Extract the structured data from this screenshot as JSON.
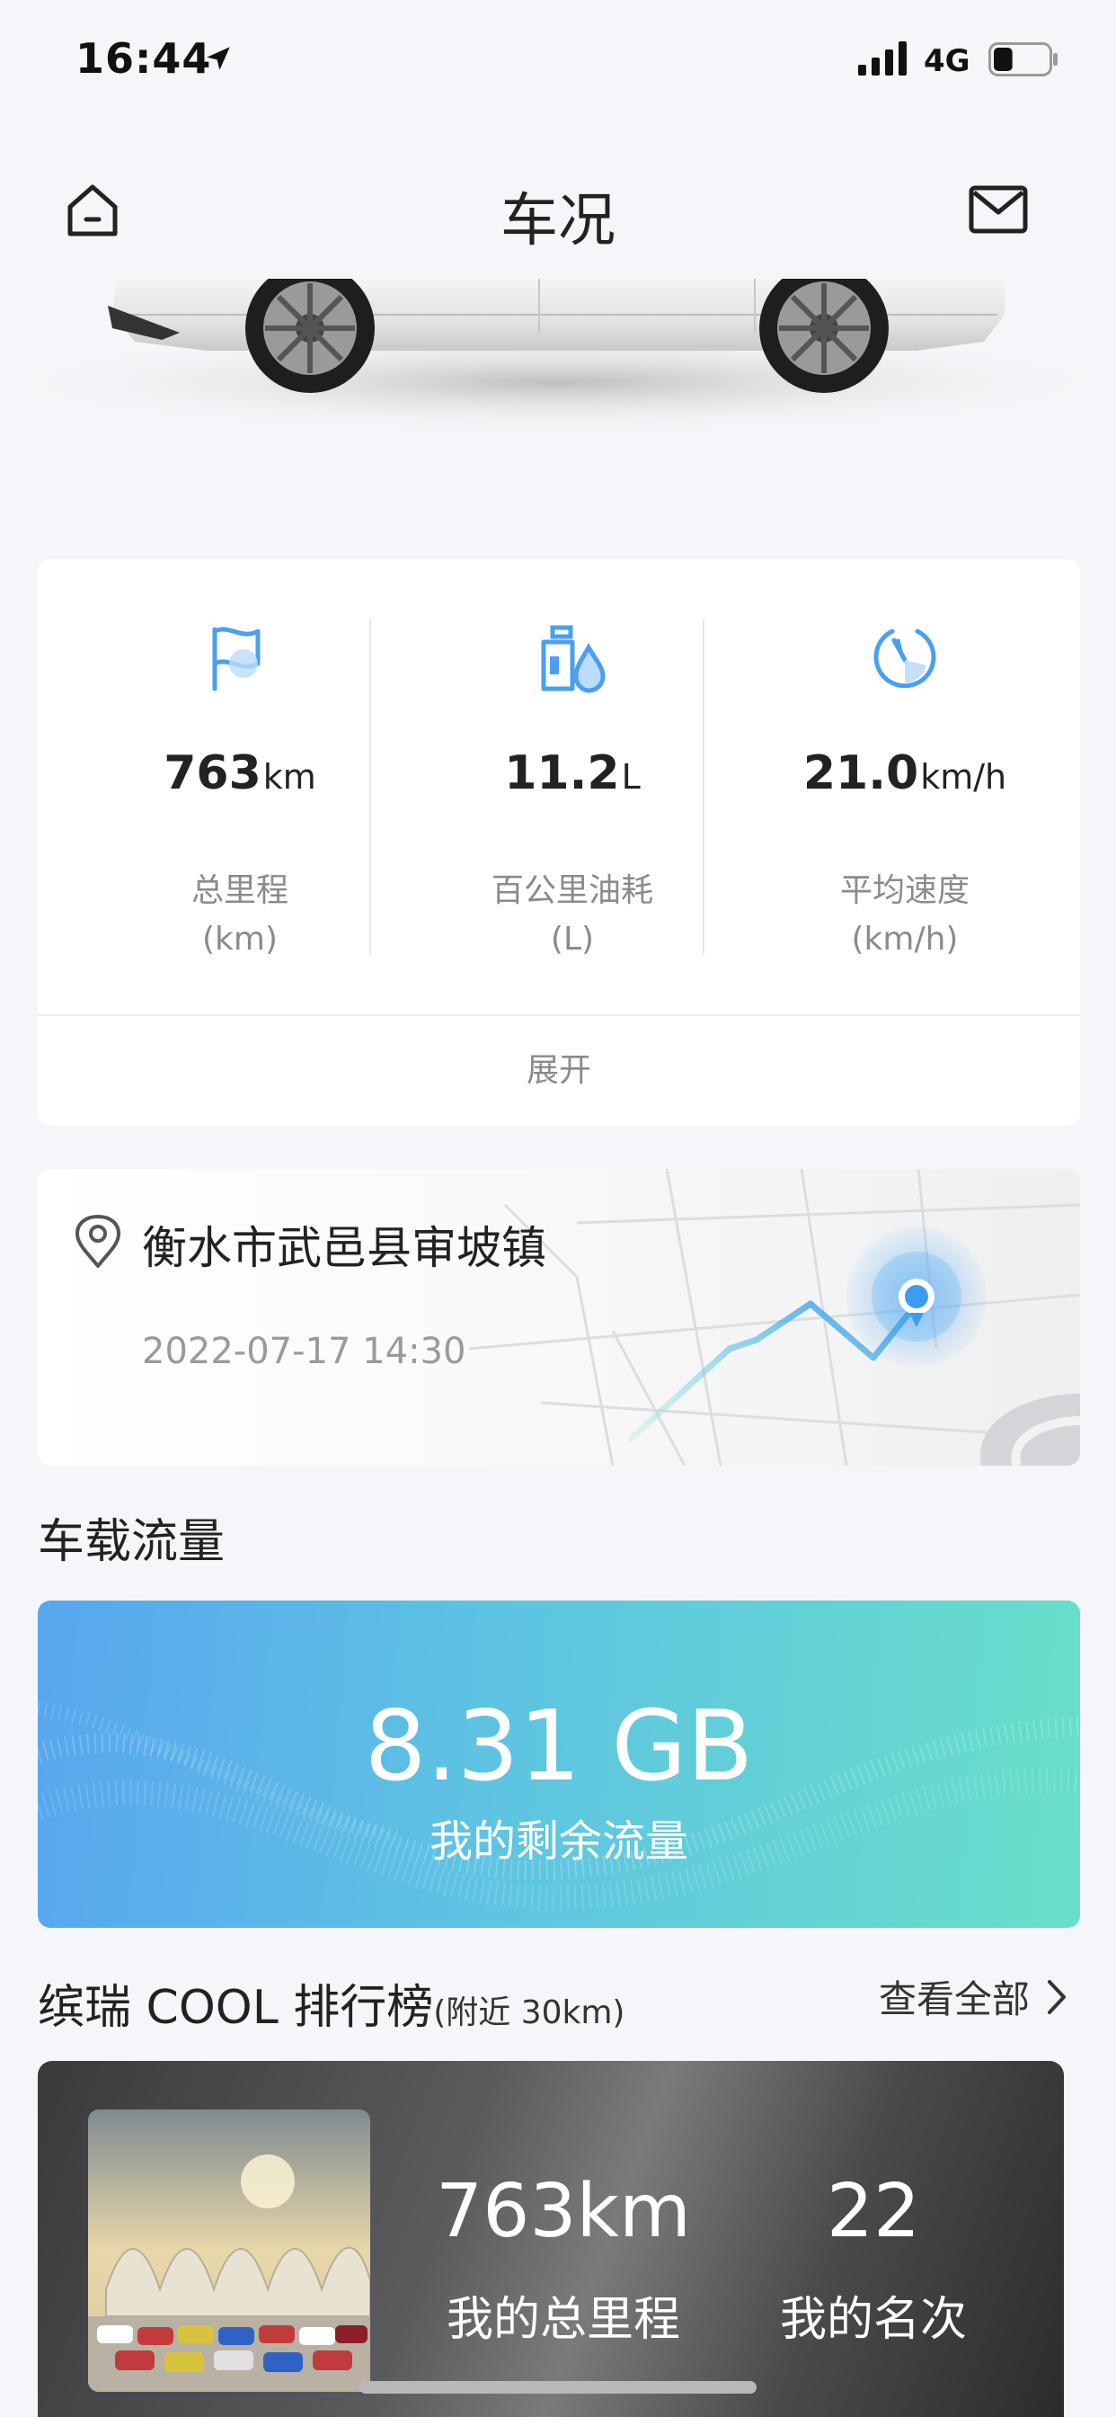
{
  "status_bar": {
    "time": "16:44",
    "network": "4G",
    "battery_level": 0.35
  },
  "header": {
    "title": "车况"
  },
  "stats": [
    {
      "value": "763",
      "unit": "km",
      "label": "总里程",
      "sub": "(km)",
      "icon": "flag-icon"
    },
    {
      "value": "11.2",
      "unit": "L",
      "label": "百公里油耗",
      "sub": "(L)",
      "icon": "fuel-icon"
    },
    {
      "value": "21.0",
      "unit": "km/h",
      "label": "平均速度",
      "sub": "(km/h)",
      "icon": "speedometer-icon"
    }
  ],
  "expand_label": "展开",
  "location": {
    "address": "衡水市武邑县审坡镇",
    "time": "2022-07-17 14:30"
  },
  "data_section": {
    "title": "车载流量",
    "value": "8.31 GB",
    "label": "我的剩余流量"
  },
  "ranking": {
    "title": "缤瑞 COOL 排行榜",
    "subtitle": "(附近 30km)",
    "see_all": "查看全部",
    "mileage": "763km",
    "mileage_label": "我的总里程",
    "position": "22",
    "position_label": "我的名次"
  },
  "colors": {
    "accent_blue": "#4a9ff0",
    "data_gradient_start": "#58a6ee",
    "data_gradient_end": "#68dfc8"
  }
}
